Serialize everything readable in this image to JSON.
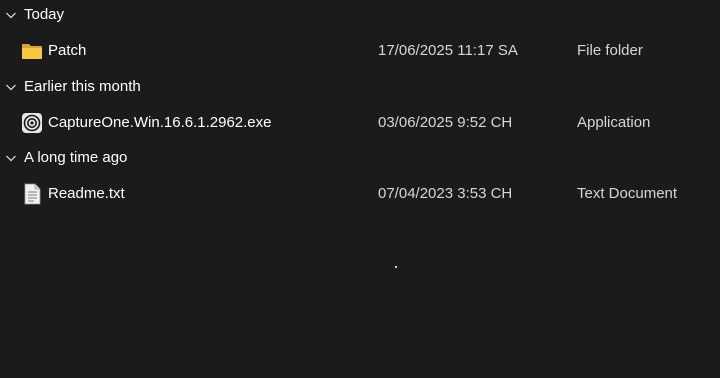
{
  "groups": [
    {
      "label": "Today",
      "files": [
        {
          "name": "Patch",
          "date": "17/06/2025 11:17 SA",
          "type": "File folder",
          "icon": "folder-icon"
        }
      ]
    },
    {
      "label": "Earlier this month",
      "files": [
        {
          "name": "CaptureOne.Win.16.6.1.2962.exe",
          "date": "03/06/2025 9:52 CH",
          "type": "Application",
          "icon": "capture-one-app-icon"
        }
      ]
    },
    {
      "label": "A long time ago",
      "files": [
        {
          "name": "Readme.txt",
          "date": "07/04/2023 3:53 CH",
          "type": "Text Document",
          "icon": "text-document-icon"
        }
      ]
    }
  ],
  "colors": {
    "background": "#1b1b1b",
    "text": "#ffffff",
    "secondary_text": "#d6d6d6",
    "folder_yellow": "#f5c542"
  }
}
